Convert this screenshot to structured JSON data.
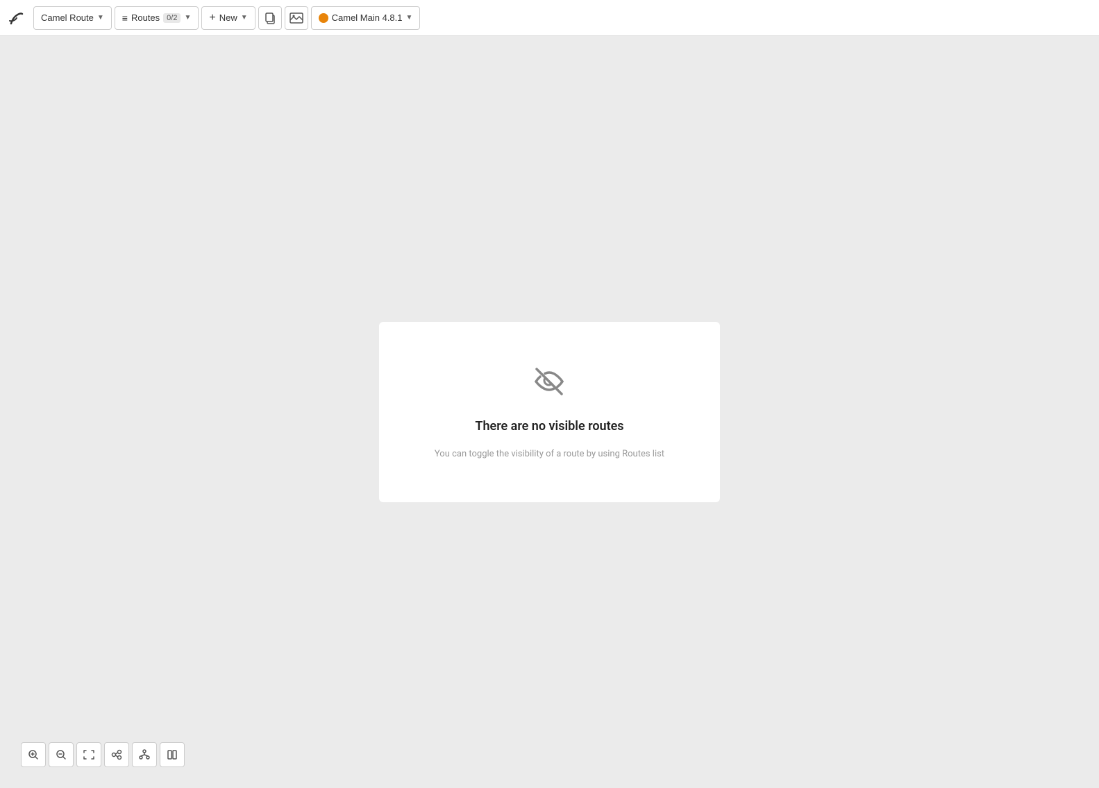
{
  "toolbar": {
    "logo_label": "Camel Route",
    "routes_label": "Routes",
    "routes_badge": "0/2",
    "new_label": "New",
    "camel_version_label": "Camel Main 4.8.1"
  },
  "canvas": {
    "empty_state": {
      "title": "There are no visible routes",
      "subtitle": "You can toggle the visibility of a route by using Routes list"
    }
  },
  "bottom_toolbar": {
    "zoom_in_label": "+",
    "zoom_out_label": "−",
    "fit_label": "⤢",
    "connect_label": "⟳",
    "layout_label": "⊞",
    "book_label": "📖"
  }
}
